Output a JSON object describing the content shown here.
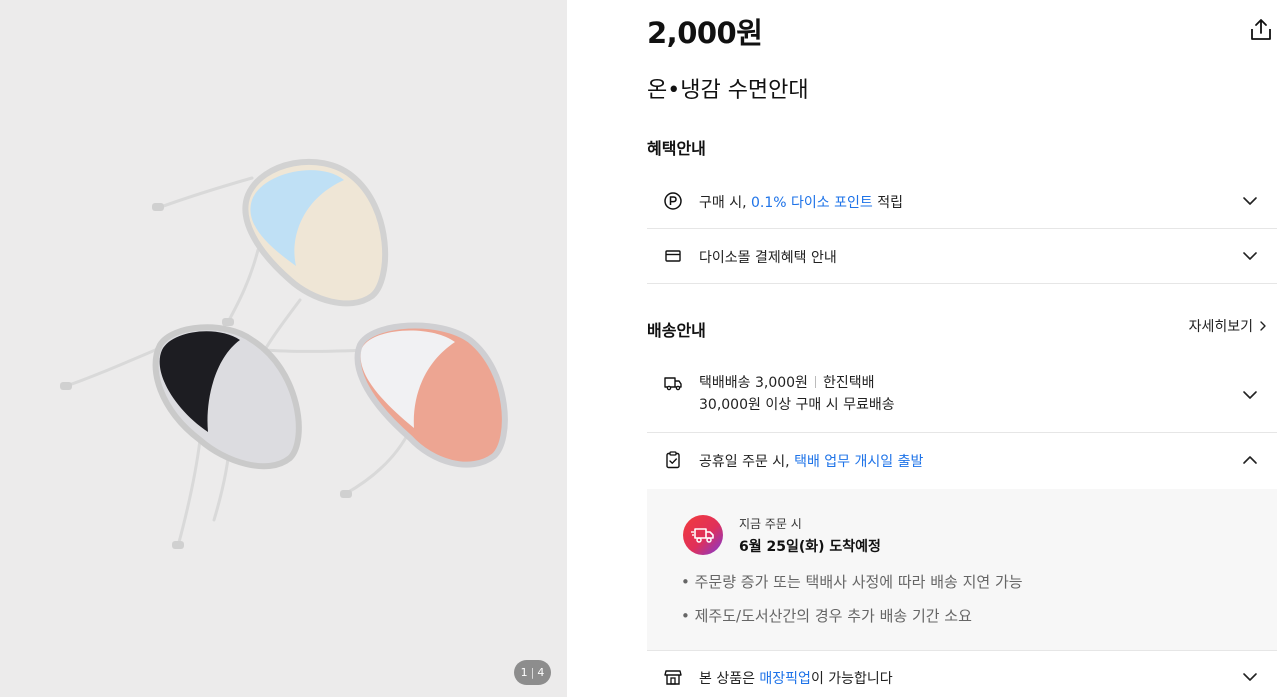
{
  "gallery": {
    "pager_current": "1",
    "pager_total": "4"
  },
  "product": {
    "price": "2,000원",
    "title": "온•냉감 수면안대"
  },
  "benefits": {
    "section_title": "혜택안내",
    "point_prefix": "구매 시, ",
    "point_highlight": "0.1% 다이소 포인트",
    "point_suffix": " 적립",
    "payment_label": "다이소몰 결제혜택 안내"
  },
  "shipping": {
    "section_title": "배송안내",
    "more_label": "자세히보기",
    "fee_label": "택배배송 3,000원",
    "carrier": "한진택배",
    "free_label": "30,000원 이상 구매 시 무료배송",
    "holiday_prefix": "공휴일 주문 시, ",
    "holiday_highlight": "택배 업무 개시일 출발",
    "now_label": "지금 주문 시",
    "eta": "6월 25일(화) 도착예정",
    "notes": [
      "• 주문량 증가 또는 택배사 사정에 따라 배송 지연 가능",
      "• 제주도/도서산간의 경우 추가 배송 기간 소요"
    ]
  },
  "pickup": {
    "prefix": "본 상품은 ",
    "highlight": "매장픽업",
    "suffix": "이 가능합니다"
  },
  "colors": {
    "accent_blue": "#1e73e8",
    "gallery_bg": "#ecebeb"
  }
}
